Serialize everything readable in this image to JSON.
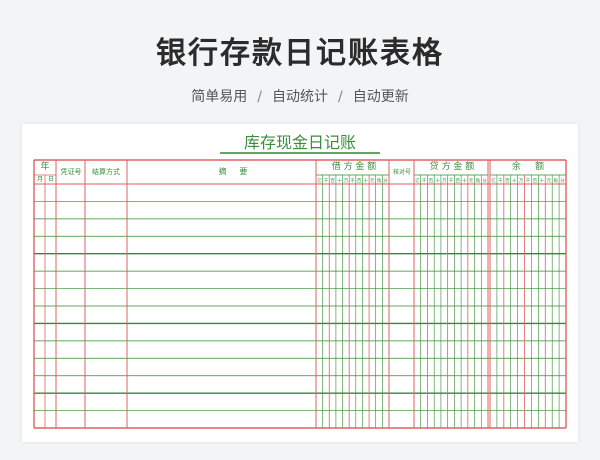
{
  "header": {
    "title": "银行存款日记账表格",
    "tags": [
      "简单易用",
      "自动统计",
      "自动更新"
    ],
    "separator": "/"
  },
  "ledger": {
    "title": "库存现金日记账",
    "headers": {
      "year": "年",
      "month": "月",
      "day": "日",
      "voucher": "凭证号",
      "method": "结算方式",
      "summary": "摘     要",
      "debit": "借 方 金 额",
      "check": "核对号",
      "credit": "贷 方 金 额",
      "balance": "余     额"
    },
    "digit_labels": [
      "亿",
      "千",
      "百",
      "十",
      "万",
      "千",
      "百",
      "十",
      "元",
      "角",
      "分"
    ],
    "data_rows": 14
  },
  "colors": {
    "green": "#2e8b2e",
    "red": "#e06060",
    "title_text": "#2b2b2b",
    "ledger_text": "#3c8c3c"
  }
}
